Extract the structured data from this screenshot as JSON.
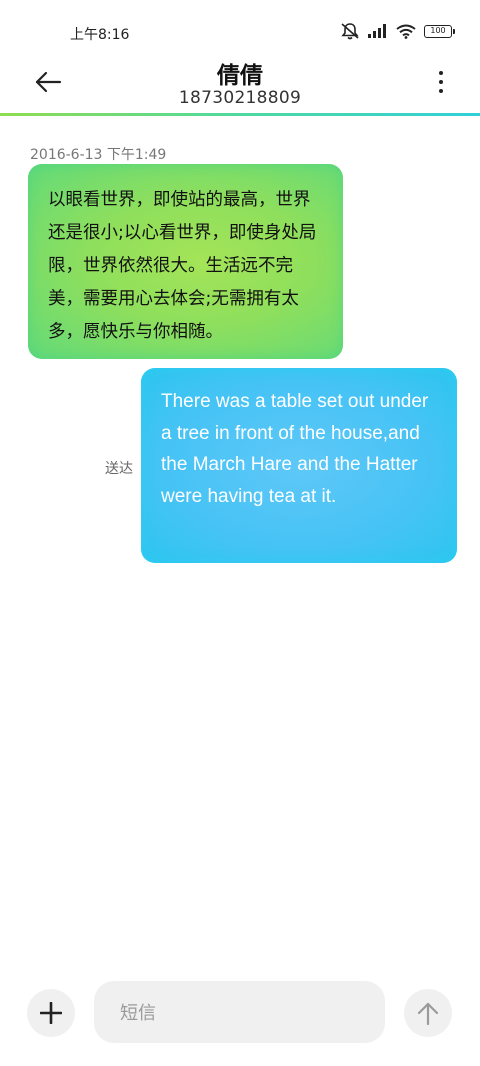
{
  "status_bar": {
    "time": "上午8:16",
    "battery_level": "100",
    "icons": [
      "mute-icon",
      "signal-icon",
      "wifi-icon",
      "battery-icon"
    ]
  },
  "header": {
    "contact_name": "倩倩",
    "contact_number": "18730218809",
    "back_icon": "arrow-left-icon",
    "more_icon": "more-vertical-icon"
  },
  "conversation": {
    "timestamp": "2016-6-13 下午1:49",
    "messages": [
      {
        "direction": "incoming",
        "text": "以眼看世界，即使站的最高，世界还是很小;以心看世界，即使身处局限，世界依然很大。生活远不完美，需要用心去体会;无需拥有太多，愿快乐与你相随。"
      },
      {
        "direction": "outgoing",
        "text": "There was a table set out under a tree in front of the house,and the March Hare and the Hatter were having tea at it.",
        "status": "送达"
      }
    ]
  },
  "composer": {
    "placeholder": "短信",
    "add_icon": "plus-icon",
    "send_icon": "arrow-up-icon"
  },
  "colors": {
    "incoming_bubble": "#8fdf5c",
    "outgoing_bubble": "#48c3f5",
    "header_line": "#4fd9a0"
  }
}
